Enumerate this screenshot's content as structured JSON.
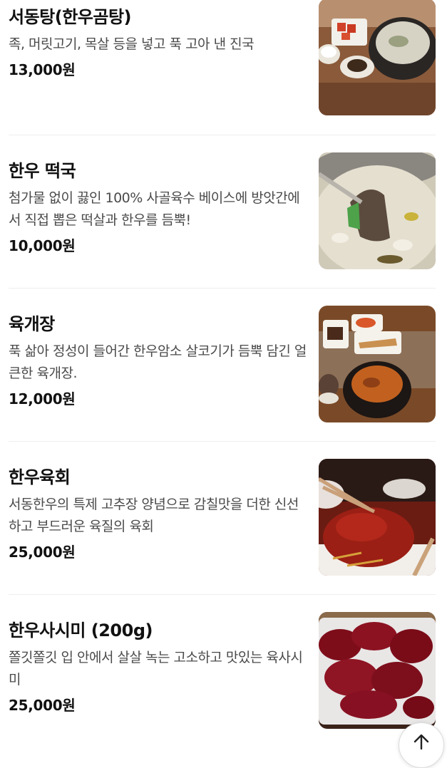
{
  "menu": {
    "items": [
      {
        "name": "서동탕(한우곰탕)",
        "description": "족, 머릿고기, 목살 등을 넣고 푹 고아 낸 진국",
        "price": "13,000원",
        "photo_icon": "gomtang-photo"
      },
      {
        "name": "한우 떡국",
        "description": "첨가물 없이 끓인 100% 사골육수 베이스에 방앗간에서 직접 뽑은 떡살과 한우를 듬뿍!",
        "price": "10,000원",
        "photo_icon": "tteokguk-photo"
      },
      {
        "name": "육개장",
        "description": "푹 삶아 정성이 들어간 한우암소 살코기가 듬뿍 담긴 얼큰한 육개장.",
        "price": "12,000원",
        "photo_icon": "yukgaejang-photo"
      },
      {
        "name": "한우육회",
        "description": "서동한우의 특제 고추장 양념으로 감칠맛을 더한 신선하고 부드러운 육질의 육회",
        "price": "25,000원",
        "photo_icon": "yukhoe-photo"
      },
      {
        "name": "한우사시미 (200g)",
        "description": "쫄깃쫄깃 입 안에서 살살 녹는 고소하고 맛있는 육사시미",
        "price": "25,000원",
        "photo_icon": "sashimi-photo"
      }
    ]
  },
  "scroll_top": {
    "icon": "arrow-up-icon"
  }
}
